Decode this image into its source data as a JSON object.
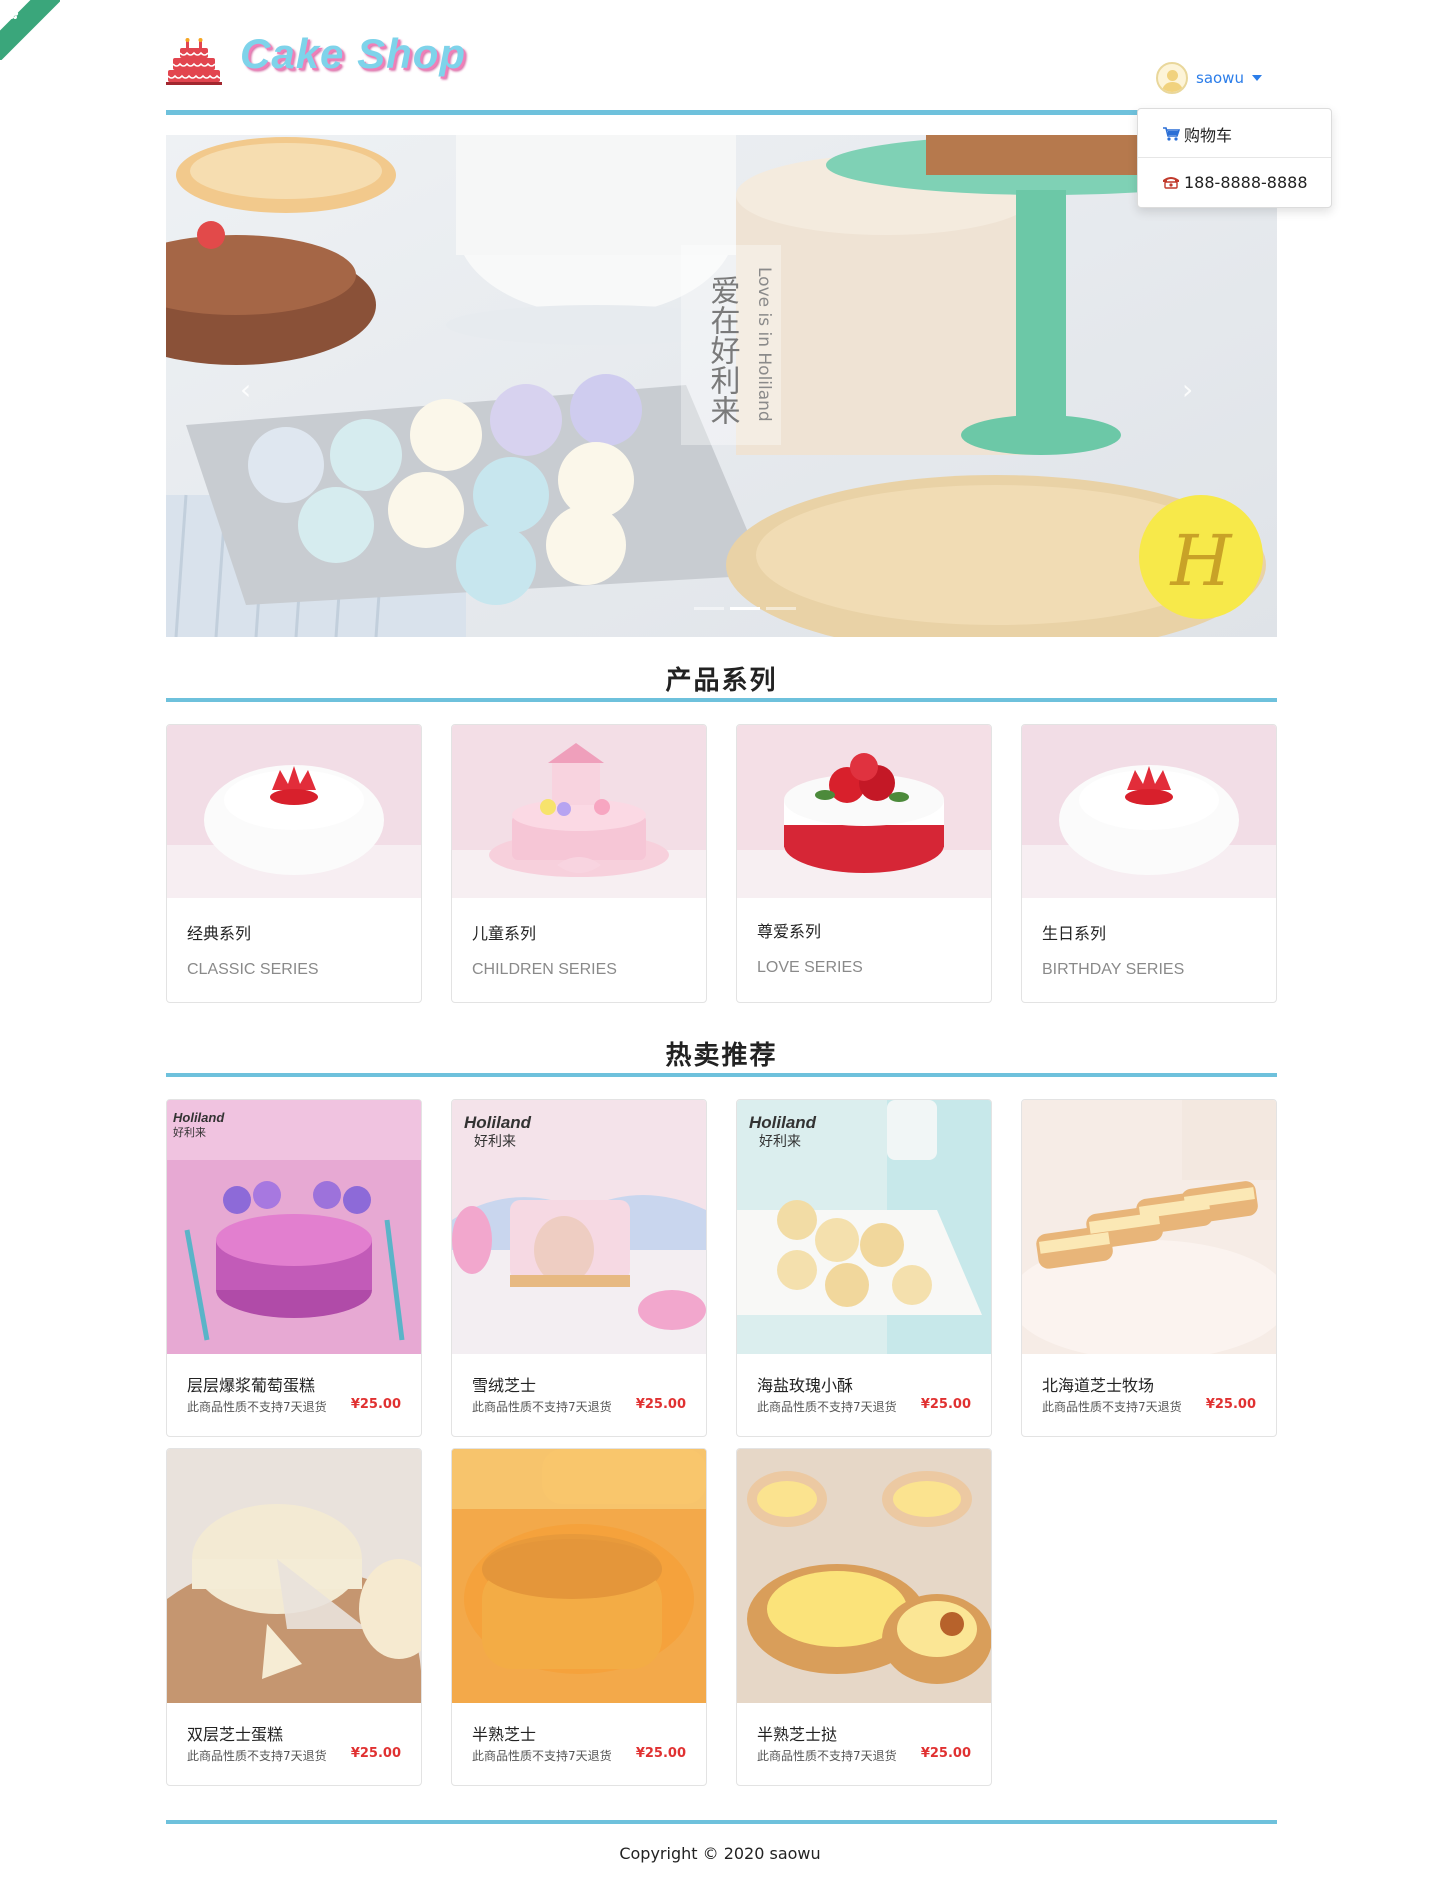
{
  "header": {
    "brand": "Cake Shop",
    "username": "saowu"
  },
  "dropdown": {
    "items": [
      {
        "label": "购物车",
        "icon": "cart-icon"
      },
      {
        "label": "188-8888-8888",
        "icon": "phone-icon"
      }
    ]
  },
  "banner": {
    "overlay_cn": "爱在好利来",
    "overlay_en": "Love is in Holiland",
    "slide_count": 3,
    "active_slide": 1
  },
  "sections": {
    "categories_title": "产品系列",
    "hot_title": "热卖推荐"
  },
  "categories": [
    {
      "name": "经典系列",
      "en": "CLASSIC SERIES"
    },
    {
      "name": "儿童系列",
      "en": "CHILDREN SERIES"
    },
    {
      "name": "尊爱系列",
      "en": "LOVE SERIES"
    },
    {
      "name": "生日系列",
      "en": "BIRTHDAY SERIES"
    }
  ],
  "products": [
    {
      "name": "层层爆浆葡萄蛋糕",
      "note": "此商品性质不支持7天退货",
      "price": "¥25.00"
    },
    {
      "name": "雪绒芝士",
      "note": "此商品性质不支持7天退货",
      "price": "¥25.00"
    },
    {
      "name": "海盐玫瑰小酥",
      "note": "此商品性质不支持7天退货",
      "price": "¥25.00"
    },
    {
      "name": "北海道芝士牧场",
      "note": "此商品性质不支持7天退货",
      "price": "¥25.00"
    },
    {
      "name": "双层芝士蛋糕",
      "note": "此商品性质不支持7天退货",
      "price": "¥25.00"
    },
    {
      "name": "半熟芝士",
      "note": "此商品性质不支持7天退货",
      "price": "¥25.00"
    },
    {
      "name": "半熟芝士挞",
      "note": "此商品性质不支持7天退货",
      "price": "¥25.00"
    }
  ],
  "product_brand": "Holiland",
  "product_brand_cn": "好利来",
  "footer": {
    "copyright": "Copyright © 2020 saowu"
  },
  "colors": {
    "accent_rule": "#6ec1dc",
    "price": "#e03131",
    "link": "#2b7de9"
  }
}
